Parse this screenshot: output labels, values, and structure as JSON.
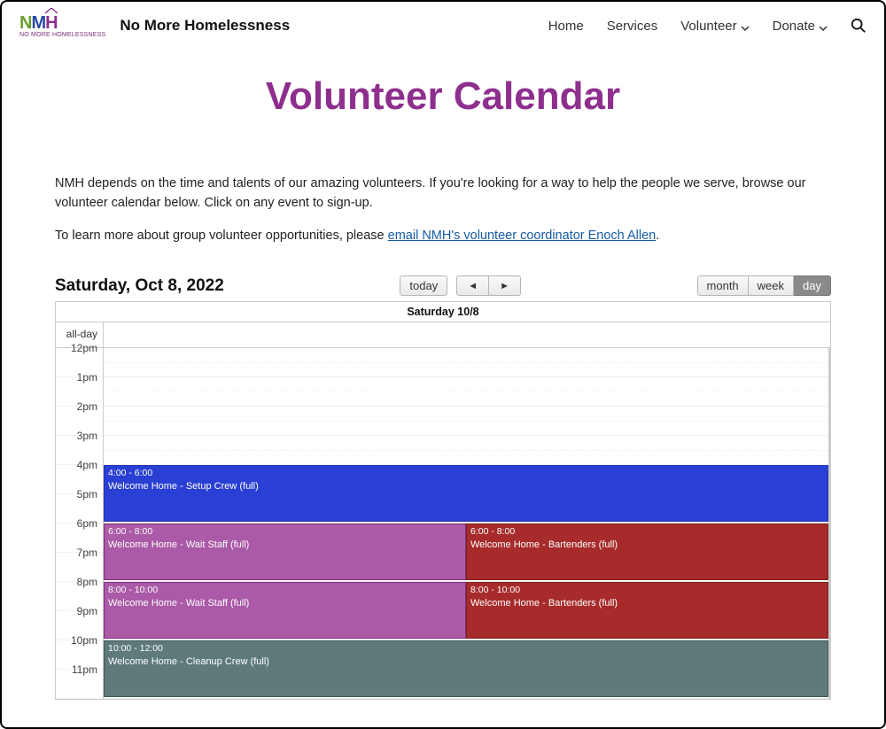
{
  "header": {
    "site_title": "No More Homelessness",
    "logo_sub": "NO MORE HOMELESSNESS",
    "nav": {
      "home": "Home",
      "services": "Services",
      "volunteer": "Volunteer",
      "donate": "Donate"
    }
  },
  "page": {
    "title": "Volunteer Calendar",
    "intro": "NMH depends on the time and talents of our amazing volunteers. If you're looking for a way to help the people we serve, browse our volunteer calendar below. Click on any event to sign-up.",
    "learn_prefix": "To learn more about group volunteer opportunities, please ",
    "learn_link": "email NMH's volunteer coordinator Enoch Allen",
    "learn_suffix": "."
  },
  "calendar": {
    "title": "Saturday, Oct 8, 2022",
    "day_header": "Saturday 10/8",
    "allday_label": "all-day",
    "buttons": {
      "today": "today",
      "prev": "◄",
      "next": "►",
      "month": "month",
      "week": "week",
      "day": "day"
    },
    "hours": [
      "12pm",
      "1pm",
      "2pm",
      "3pm",
      "4pm",
      "5pm",
      "6pm",
      "7pm",
      "8pm",
      "9pm",
      "10pm",
      "11pm"
    ],
    "events": [
      {
        "time": "4:00 - 6:00",
        "title": "Welcome Home - Setup Crew (full)"
      },
      {
        "time": "6:00 - 8:00",
        "title": "Welcome Home - Wait Staff (full)"
      },
      {
        "time": "6:00 - 8:00",
        "title": "Welcome Home - Bartenders (full)"
      },
      {
        "time": "8:00 - 10:00",
        "title": "Welcome Home - Wait Staff (full)"
      },
      {
        "time": "8:00 - 10:00",
        "title": "Welcome Home - Bartenders (full)"
      },
      {
        "time": "10:00 - 12:00",
        "title": "Welcome Home - Cleanup Crew (full)"
      }
    ]
  }
}
